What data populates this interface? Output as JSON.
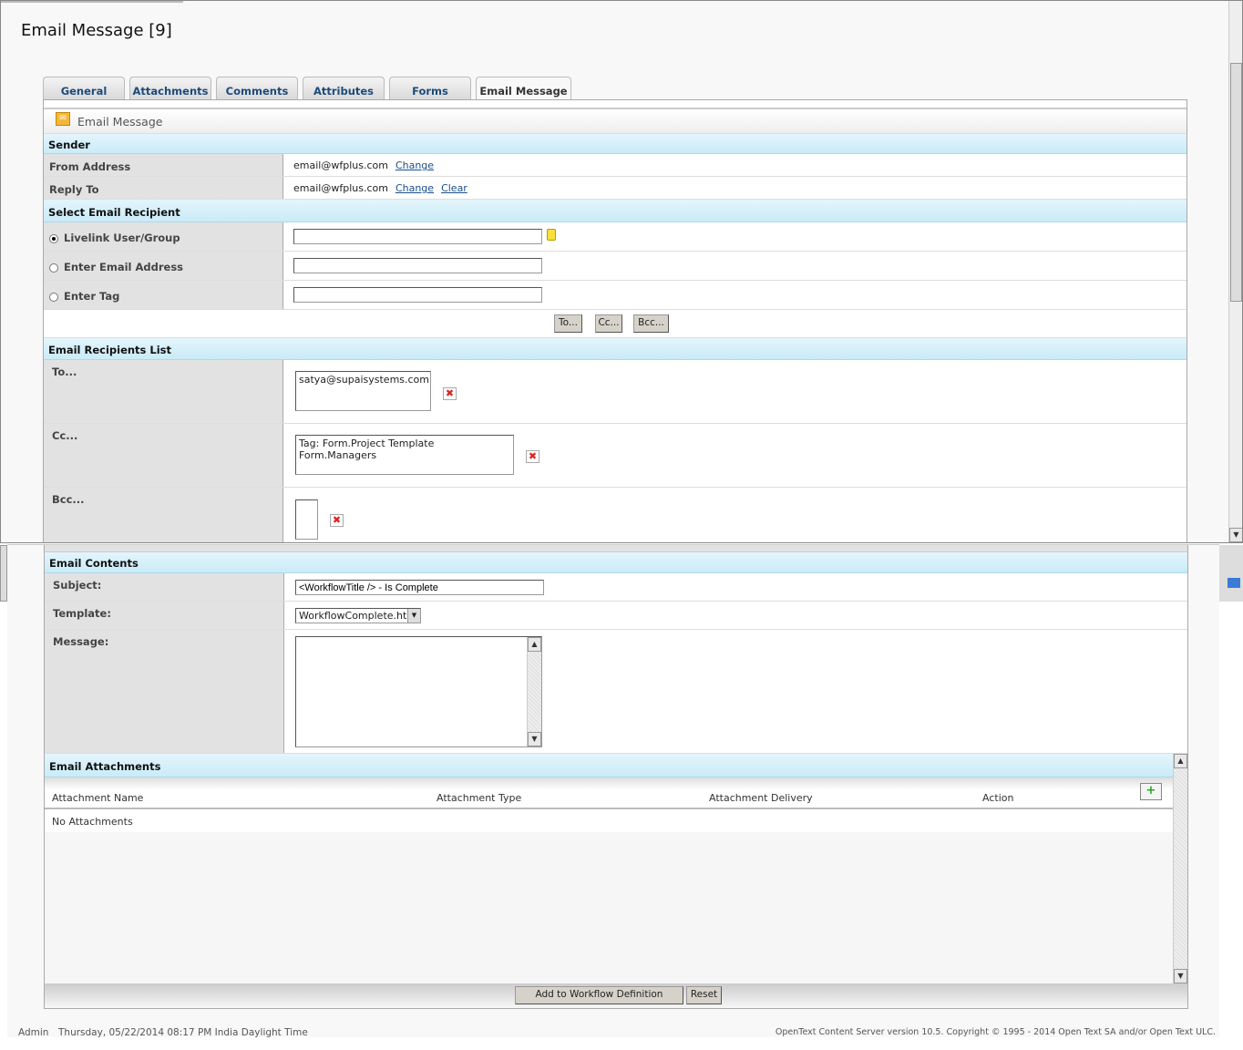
{
  "page": {
    "title": "Email Message [9]"
  },
  "tabs": [
    "General",
    "Attachments",
    "Comments",
    "Attributes",
    "Forms",
    "Email Message"
  ],
  "panel_title": "Email Message",
  "sender": {
    "heading": "Sender",
    "from_label": "From Address",
    "from_value": "email@wfplus.com",
    "reply_label": "Reply To",
    "reply_value": "email@wfplus.com",
    "change": "Change",
    "clear": "Clear"
  },
  "recipient": {
    "heading": "Select Email Recipient",
    "options": [
      "Livelink User/Group",
      "Enter Email Address",
      "Enter Tag"
    ],
    "selected": "Livelink User/Group",
    "user_value": "",
    "email_value": "",
    "tag_value": "",
    "to_btn": "To...",
    "cc_btn": "Cc...",
    "bcc_btn": "Bcc..."
  },
  "recipients_list": {
    "heading": "Email Recipients List",
    "to_label": "To...",
    "to_items": [
      "satya@supaisystems.com"
    ],
    "cc_label": "Cc...",
    "cc_items": [
      "Tag: Form.Project Template Form.Managers"
    ],
    "bcc_label": "Bcc..."
  },
  "contents": {
    "heading": "Email Contents",
    "subject_label": "Subject:",
    "subject_value": "<WorkflowTitle /> - Is Complete",
    "template_label": "Template:",
    "template_value": "WorkflowComplete.html",
    "message_label": "Message:",
    "message_value": ""
  },
  "attachments": {
    "heading": "Email Attachments",
    "columns": [
      "Attachment Name",
      "Attachment Type",
      "Attachment Delivery",
      "Action"
    ],
    "empty": "No Attachments"
  },
  "actions": {
    "add": "Add to Workflow Definition",
    "reset": "Reset"
  },
  "footer": {
    "user": "Admin",
    "datetime": "Thursday, 05/22/2014 08:17 PM India Daylight Time",
    "copyright": "OpenText Content Server version 10.5. Copyright © 1995 - 2014 Open Text SA and/or Open Text ULC."
  },
  "colors": {
    "section_header": "#c9ebf8",
    "link": "#1a4e8c",
    "tab_text": "#1e4a7a"
  }
}
